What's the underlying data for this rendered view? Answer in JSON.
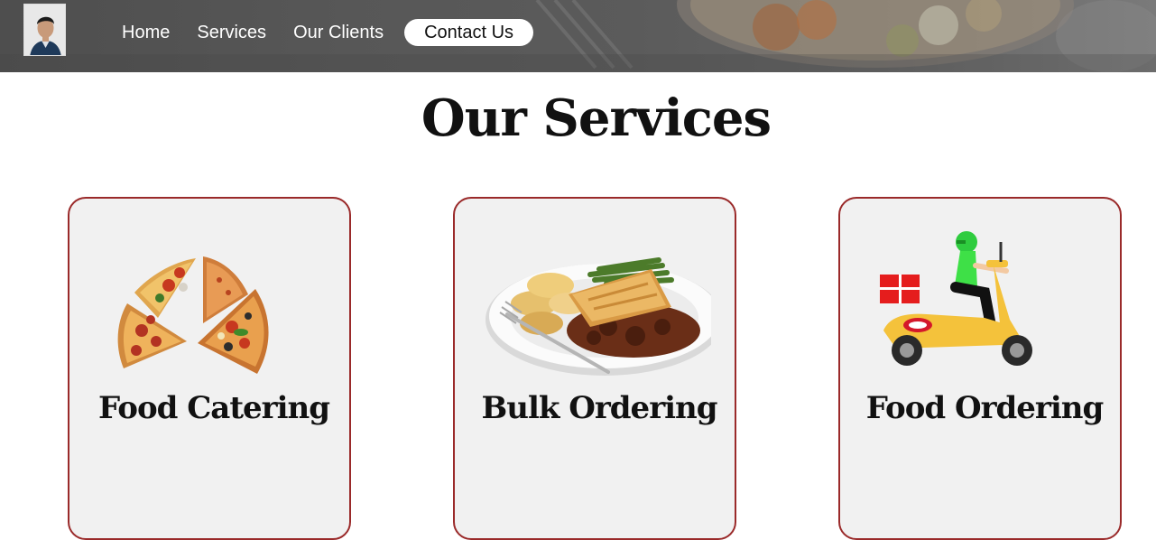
{
  "navbar": {
    "logo_alt": "Profile photo",
    "links": [
      {
        "label": "Home"
      },
      {
        "label": "Services"
      },
      {
        "label": "Our Clients"
      },
      {
        "label": "Contact Us"
      }
    ],
    "active_index": 3
  },
  "page": {
    "title": "Our Services"
  },
  "services": [
    {
      "title": "Food Catering",
      "image": "pizza-slices-image"
    },
    {
      "title": "Bulk Ordering",
      "image": "pie-plate-image"
    },
    {
      "title": "Food Ordering",
      "image": "delivery-scooter-image"
    }
  ],
  "colors": {
    "card_border": "#9a2a2a",
    "card_background": "#f1f1f1",
    "nav_background": "#555555",
    "active_pill": "#ffffff"
  }
}
